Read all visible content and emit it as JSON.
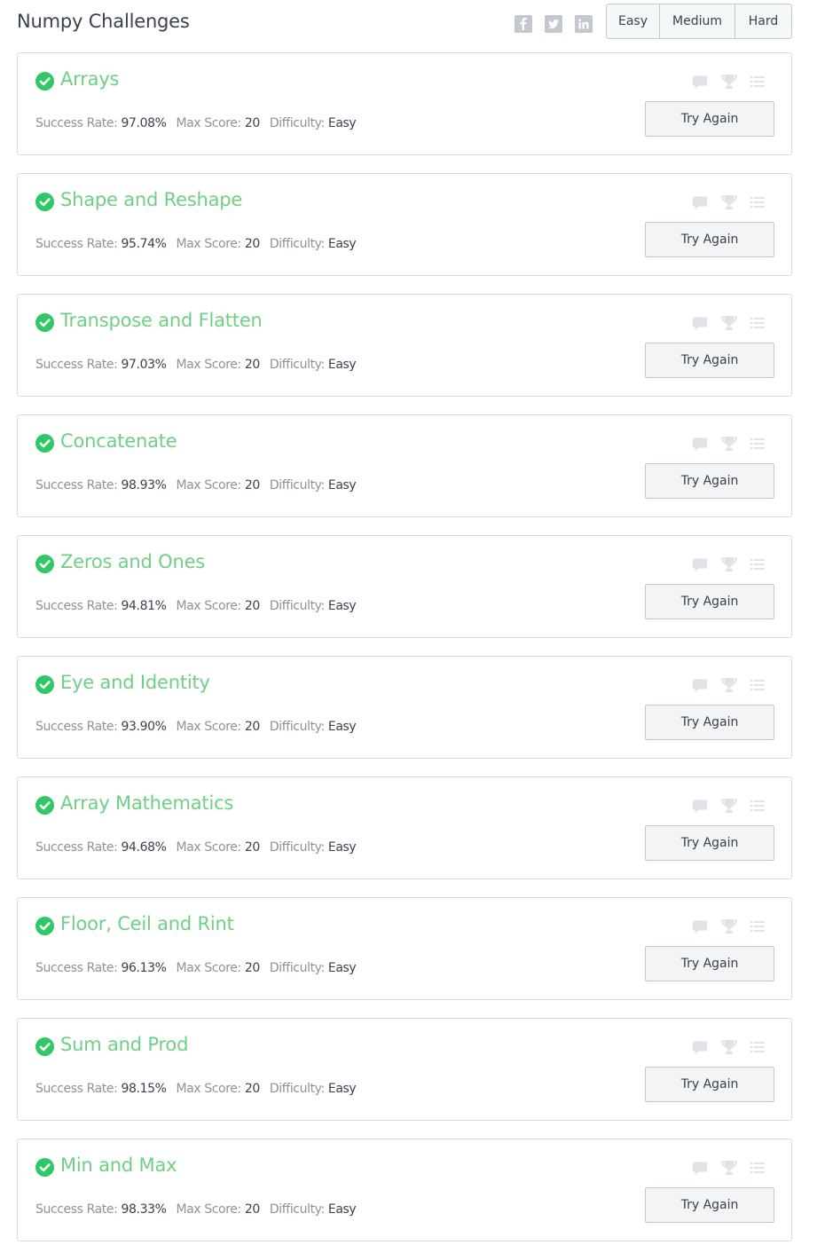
{
  "header": {
    "title": "Numpy Challenges",
    "social": [
      "facebook-icon",
      "twitter-icon",
      "linkedin-icon"
    ],
    "difficulty_filters": [
      "Easy",
      "Medium",
      "Hard"
    ]
  },
  "labels": {
    "success_rate": "Success Rate:",
    "max_score": "Max Score:",
    "difficulty": "Difficulty:",
    "action": "Try Again"
  },
  "colors": {
    "accent_green": "#6fcf84",
    "check_green": "#2ec866",
    "muted_icon": "#dfe2e6"
  },
  "challenges": [
    {
      "title": "Arrays",
      "success_rate": "97.08%",
      "max_score": "20",
      "difficulty": "Easy",
      "status": "solved"
    },
    {
      "title": "Shape and Reshape",
      "success_rate": "95.74%",
      "max_score": "20",
      "difficulty": "Easy",
      "status": "solved"
    },
    {
      "title": "Transpose and Flatten",
      "success_rate": "97.03%",
      "max_score": "20",
      "difficulty": "Easy",
      "status": "solved"
    },
    {
      "title": "Concatenate",
      "success_rate": "98.93%",
      "max_score": "20",
      "difficulty": "Easy",
      "status": "solved"
    },
    {
      "title": "Zeros and Ones",
      "success_rate": "94.81%",
      "max_score": "20",
      "difficulty": "Easy",
      "status": "solved"
    },
    {
      "title": "Eye and Identity",
      "success_rate": "93.90%",
      "max_score": "20",
      "difficulty": "Easy",
      "status": "solved"
    },
    {
      "title": "Array Mathematics",
      "success_rate": "94.68%",
      "max_score": "20",
      "difficulty": "Easy",
      "status": "solved"
    },
    {
      "title": "Floor, Ceil and Rint",
      "success_rate": "96.13%",
      "max_score": "20",
      "difficulty": "Easy",
      "status": "solved"
    },
    {
      "title": "Sum and Prod",
      "success_rate": "98.15%",
      "max_score": "20",
      "difficulty": "Easy",
      "status": "solved"
    },
    {
      "title": "Min and Max",
      "success_rate": "98.33%",
      "max_score": "20",
      "difficulty": "Easy",
      "status": "solved"
    }
  ]
}
